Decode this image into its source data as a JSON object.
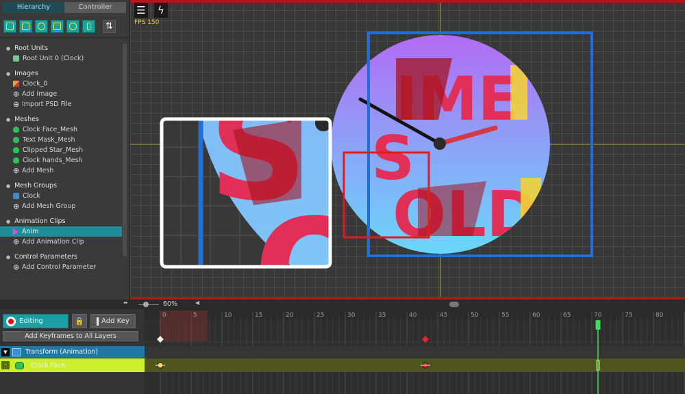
{
  "hierarchy": {
    "tabs": [
      {
        "label": "Hierarchy",
        "active": true
      },
      {
        "label": "Controller",
        "active": false
      }
    ],
    "toolbar_icons": [
      "root-unit-icon",
      "image-icon",
      "mesh-icon",
      "mesh-group-icon",
      "animation-icon",
      "control-param-icon",
      "sort-icon"
    ],
    "sections": [
      {
        "label": "Root Units",
        "items": [
          {
            "label": "Root Unit 0 (Clock)",
            "icon": "root-unit-icon",
            "selected": false
          }
        ]
      },
      {
        "label": "Images",
        "items": [
          {
            "label": "Clock_0",
            "icon": "image-icon",
            "selected": false
          },
          {
            "label": "Add Image",
            "icon": "plus-icon",
            "selected": false
          },
          {
            "label": "Import PSD File",
            "icon": "plus-icon",
            "selected": false
          }
        ]
      },
      {
        "label": "Meshes",
        "items": [
          {
            "label": "Clock Face_Mesh",
            "icon": "mesh-icon",
            "selected": false
          },
          {
            "label": "Text Mask_Mesh",
            "icon": "mesh-icon",
            "selected": false
          },
          {
            "label": "Clipped Star_Mesh",
            "icon": "mesh-icon",
            "selected": false
          },
          {
            "label": "Clock hands_Mesh",
            "icon": "mesh-icon",
            "selected": false
          },
          {
            "label": "Add Mesh",
            "icon": "plus-icon",
            "selected": false
          }
        ]
      },
      {
        "label": "Mesh Groups",
        "items": [
          {
            "label": "Clock",
            "icon": "mesh-group-icon",
            "selected": false
          },
          {
            "label": "Add Mesh Group",
            "icon": "plus-icon",
            "selected": false
          }
        ]
      },
      {
        "label": "Animation Clips",
        "items": [
          {
            "label": "Anim",
            "icon": "play-icon",
            "selected": true
          },
          {
            "label": "Add Animation Clip",
            "icon": "plus-icon",
            "selected": false
          }
        ]
      },
      {
        "label": "Control Parameters",
        "items": [
          {
            "label": "Add Control Parameter",
            "icon": "plus-icon",
            "selected": false
          }
        ]
      }
    ]
  },
  "viewport": {
    "fps_label": "FPS 150",
    "menu_icon": "hamburger-icon",
    "bolt_icon": "lightning-icon",
    "clock_text_top": "IME",
    "clock_text_mid": "S",
    "clock_text_bottom": "OLD",
    "zoom_text_top": "S",
    "zoom_text_bottom": "O",
    "colors": {
      "grid_bg": "#383838",
      "border_red": "#b01818",
      "selection_blue": "#1f6fd6",
      "clock_top": "#b26cf5",
      "clock_bottom": "#69d7fa",
      "letter_red": "#e03058",
      "letter_dark": "#a41320"
    }
  },
  "status": {
    "zoom": "60%"
  },
  "timeline": {
    "editing_label": "Editing",
    "add_key_label": "Add Key",
    "add_all_label": "Add Keyframes to All Layers",
    "layers": [
      {
        "label": "Transform (Animation)",
        "toggle": "▼"
      },
      {
        "label": "Clock Face",
        "toggle": "-"
      }
    ],
    "frame_ticks": [
      0,
      5,
      10,
      15,
      20,
      25,
      30,
      35,
      40,
      45,
      50,
      55,
      60,
      65,
      70,
      75,
      80,
      85
    ],
    "current_frame": 71,
    "keyframes": [
      0,
      43
    ],
    "colors": {
      "playhead": "#39e05a",
      "keyframe": "#e02a2a",
      "track": "#505520"
    }
  }
}
